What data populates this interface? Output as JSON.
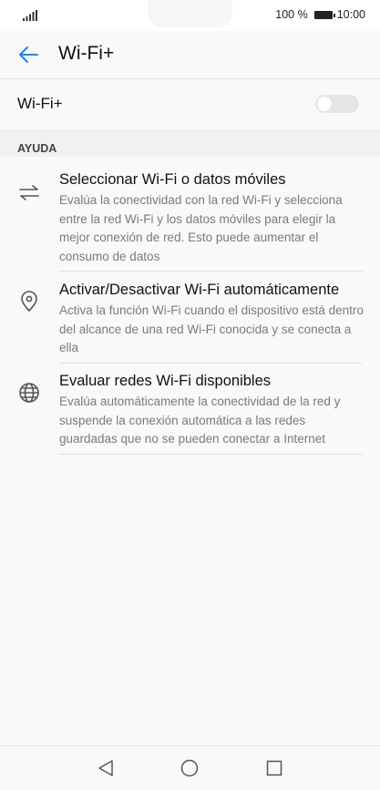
{
  "status_bar": {
    "battery_percent": "100 %",
    "time": "10:00",
    "signal_icon": "signal-icon",
    "battery_icon": "battery-icon"
  },
  "header": {
    "back_icon": "back-arrow-icon",
    "title": "Wi-Fi+"
  },
  "toggle": {
    "label": "Wi-Fi+",
    "enabled": false
  },
  "help_section": {
    "title": "AYUDA",
    "items": [
      {
        "icon": "swap-arrows-icon",
        "title": "Seleccionar Wi-Fi o datos móviles",
        "description": "Evalúa la conectividad con la red Wi-Fi y selecciona entre la red Wi-Fi y los datos móviles para elegir la mejor conexión de red. Esto puede aumentar el consumo de datos"
      },
      {
        "icon": "location-pin-icon",
        "title": "Activar/Desactivar Wi-Fi automáticamente",
        "description": "Activa la función Wi-Fi cuando el dispositivo está dentro del alcance de una red Wi-Fi conocida y se conecta a ella"
      },
      {
        "icon": "globe-icon",
        "title": "Evaluar redes Wi-Fi disponibles",
        "description": "Evalúa automáticamente la conectividad de la red y suspende la conexión automática a las redes guardadas que no se pueden conectar a Internet"
      }
    ]
  },
  "nav_bar": {
    "back_icon": "nav-back-icon",
    "home_icon": "nav-home-icon",
    "recents_icon": "nav-recents-icon"
  },
  "colors": {
    "accent": "#1e88e5",
    "background": "#f9f9f9",
    "section_background": "#f1f1f1",
    "secondary_text": "#7a7a7a"
  }
}
